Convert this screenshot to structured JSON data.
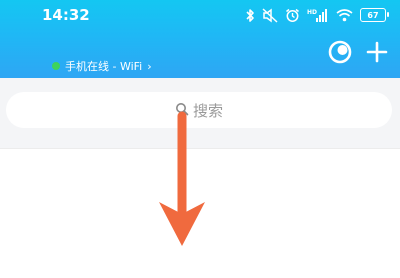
{
  "status_bar": {
    "time": "14:32",
    "battery": "67",
    "icons": [
      "bluetooth-icon",
      "mute-icon",
      "alarm-icon",
      "hd-signal-icon",
      "wifi-icon",
      "battery-icon"
    ]
  },
  "header": {
    "online_status": "手机在线 - WiFi",
    "online_dot_color": "#3ed35b",
    "actions": [
      "theme-icon",
      "add-icon"
    ]
  },
  "search": {
    "placeholder": "搜索"
  },
  "colors": {
    "header_top": "#14c7f2",
    "header_bottom": "#2ea6f4",
    "arrow": "#f06a3e"
  }
}
